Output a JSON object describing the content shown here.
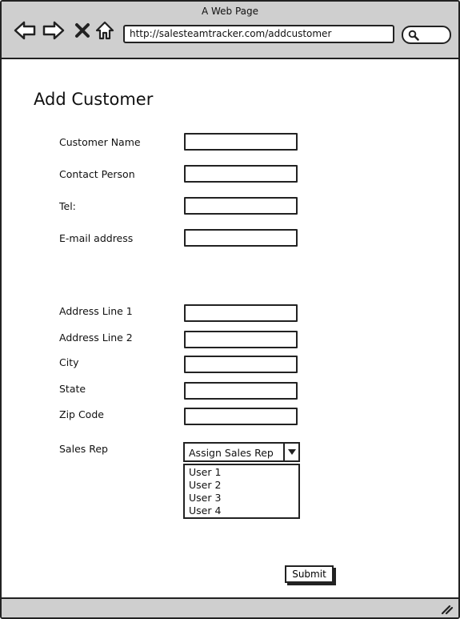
{
  "window": {
    "title": "A Web Page"
  },
  "browser": {
    "url": "http://salesteamtracker.com/addcustomer",
    "icons": [
      "back-arrow-icon",
      "forward-arrow-icon",
      "close-x-icon",
      "home-icon",
      "search-icon",
      "resize-grip-icon"
    ]
  },
  "page": {
    "title": "Add Customer"
  },
  "form": {
    "customer_name_label": "Customer Name",
    "contact_person_label": "Contact Person",
    "tel_label": "Tel:",
    "email_label": "E-mail address",
    "address1_label": "Address Line 1",
    "address2_label": "Address Line 2",
    "city_label": "City",
    "state_label": "State",
    "zip_label": "Zip Code",
    "sales_rep_label": "Sales Rep",
    "sales_rep_selected": "Assign Sales Rep",
    "sales_rep_options": [
      "User 1",
      "User 2",
      "User 3",
      "User 4"
    ],
    "submit_label": "Submit"
  },
  "colors": {
    "chrome": "#cfcfcf",
    "outline": "#222222",
    "background": "#ffffff"
  }
}
